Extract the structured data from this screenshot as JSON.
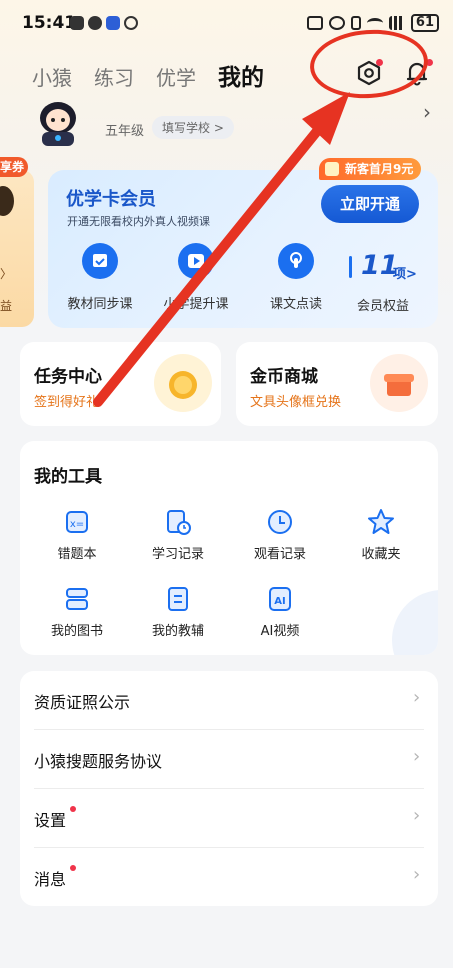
{
  "status_bar": {
    "time": "15:41",
    "battery": "61"
  },
  "top_nav": {
    "tabs": [
      {
        "label": "小猿",
        "active": false
      },
      {
        "label": "练习",
        "active": false
      },
      {
        "label": "优学",
        "active": false
      },
      {
        "label": "我的",
        "active": true
      }
    ],
    "settings_icon": "settings-icon",
    "bell_icon": "bell-icon"
  },
  "profile": {
    "grade": "五年级",
    "school": "填写学校 >"
  },
  "peek_card": {
    "badge": "享券",
    "text1": "〉",
    "text2": "益"
  },
  "vip_card": {
    "title": "优学卡会员",
    "subtitle": "开通无限看校内外真人视频课",
    "open_button": "立即开通",
    "promo": "新客首月9元",
    "features": [
      {
        "label": "教材同步课",
        "icon": "calendar-check-icon"
      },
      {
        "label": "小学提升课",
        "icon": "play-icon"
      },
      {
        "label": "课文点读",
        "icon": "tap-icon"
      }
    ],
    "benefits_count": "11",
    "benefits_unit": "项>",
    "benefits_label": "会员权益"
  },
  "task_center": {
    "title": "任务中心",
    "subtitle": "签到得好礼"
  },
  "coin_mall": {
    "title": "金币商城",
    "subtitle": "文具头像框兑换"
  },
  "tools": {
    "title": "我的工具",
    "items": [
      {
        "label": "错题本",
        "icon": "wrong-questions-icon"
      },
      {
        "label": "学习记录",
        "icon": "study-record-icon"
      },
      {
        "label": "观看记录",
        "icon": "clock-icon"
      },
      {
        "label": "收藏夹",
        "icon": "star-icon"
      },
      {
        "label": "我的图书",
        "icon": "books-icon"
      },
      {
        "label": "我的教辅",
        "icon": "workbook-icon"
      },
      {
        "label": "AI视频",
        "icon": "ai-video-icon"
      }
    ]
  },
  "menu": {
    "items": [
      {
        "label": "资质证照公示",
        "dot": false
      },
      {
        "label": "小猿搜题服务协议",
        "dot": false
      },
      {
        "label": "设置",
        "dot": true
      },
      {
        "label": "消息",
        "dot": true
      }
    ],
    "chevron": "›"
  },
  "colors": {
    "accent_blue": "#1b6ff0",
    "annotation_red": "#e63322",
    "orange": "#e5741a"
  }
}
